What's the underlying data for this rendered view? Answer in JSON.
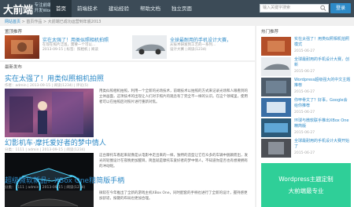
{
  "header": {
    "logo_main": "大前端",
    "logo_sub1": "专注前端",
    "logo_sub2": "开发Wordpress",
    "nav": [
      "首页",
      "前端技术",
      "建站经验",
      "帮助文档",
      "独立页面"
    ],
    "search_placeholder": "输入关键字搜索",
    "login": "登录"
  },
  "breadcrumb": {
    "home": "网站首页",
    "rest": "> 首页作品 > 大前端已成功运营到年底2013"
  },
  "featured": {
    "heading": "置顶推荐",
    "items": [
      {
        "title": "实在太强了！用类似照相机拍照",
        "desc1": "在现在照片泛滥，需要一个可以...",
        "desc2": "2013-09-15 | 标签：照相机 | 阅读"
      },
      {
        "title": "全球最耐用的手机设计大赛，",
        "desc1": "从技术研发到工艺的一系列...",
        "desc2": "设计大赛 | 阅读(1234)"
      }
    ]
  },
  "latest": {
    "heading": "最新发布"
  },
  "posts": [
    {
      "title": "实在太强了！用类似照相机拍照",
      "meta": "作者：admin | 2013-09-15 | 阅读(1234) | 评论(5)",
      "text": "用类似照相机拍照，利用一个全新的光场技术，前端技术以拍照的方式来记录光场和人眼看到的立体画面，这项技术的出现让人们对于照片的观念有了完全不一样的认识。在这个领域里，使用者可以在拍照后对照片进行重新对焦。"
    },
    {
      "title": "幻影机车·摩托爱好者的梦中情人",
      "meta": "分类：1111 | admin | 2013-09-15 | 阅读(1234)",
      "text": "这台摩托车看起来就像是从电影中走出来的一样，独特的造型让它在众多的车辆中脱颖而出，发光的轮圈设计在夜晚更加醒目，简直就是摩托车爱好者的梦中情人，不知道你是否也有想要拥有的冲动呢。"
    },
    {
      "title": "超级微软新品：XBox One精简版手柄",
      "meta": "分类：1111 | admin | 2013-09-15 | 阅读(1234)",
      "text": "微软在今年推出了全新的游戏主机XBox One，同时配套的手柄也进行了全新的设计，握持感更加舒适，按键的布局也更加合理。"
    }
  ],
  "sidebar": {
    "heading": "热门推荐",
    "items": [
      {
        "title": "实在太强了！用类似照相机拍照模式",
        "date": "2015-06-27"
      },
      {
        "title": "全球最耐用的手机设计大赛，创新",
        "date": "2015-06-27"
      },
      {
        "title": "Wordpress超级强大的中文主题推荐",
        "date": "2015-06-27"
      },
      {
        "title": "你甲骨文了？好事，Google会给你推荐",
        "date": "2015-06-27"
      },
      {
        "title": "环球与微软联手推出XBox One精简版",
        "date": "2015-06-27"
      },
      {
        "title": "全球最耐用的手机设计大赛开始了",
        "date": "2015-06-27"
      },
      {
        "title": "让你体验不一样的科技感",
        "date": "2015-06-27"
      }
    ],
    "promo_line1": "Wordpress主题定制",
    "promo_line2": "大前端最专业"
  },
  "colors": {
    "topbar": "#3c4b57",
    "link": "#2d8ac7",
    "promo": "#2fcf98"
  }
}
